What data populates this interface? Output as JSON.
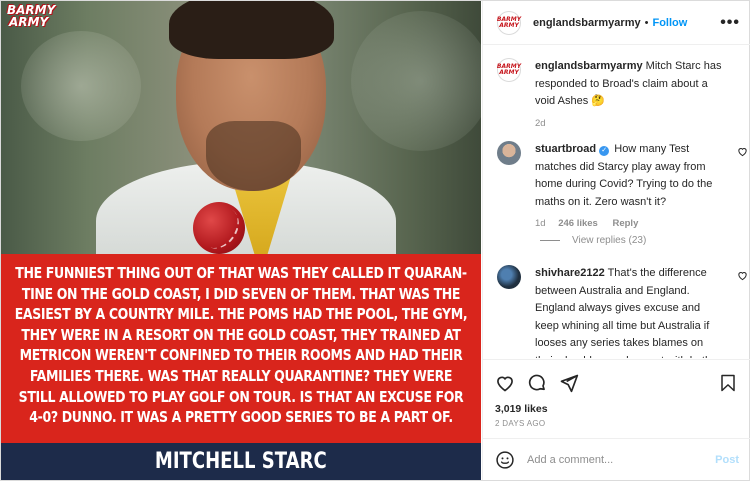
{
  "post": {
    "logo_line1": "BARMY",
    "logo_line2": "ARMY",
    "quote": "The funniest thing out of that was they called it quarantine on the Gold Coast, I did seven of them. That was the easiest by a country mile. The Poms had the pool, the gym, they were in a resort on the Gold Coast, they trained at Metricon weren't confined to their rooms and had their families there. Was that really quarantine? They were still allowed to play golf on tour. Is that an excuse for 4-0? Dunno. It was a pretty good series to be a part of.",
    "quote_lines": [
      "The funniest thing out of that was they called it quaran-",
      "tine on the Gold Coast, I did seven of them. That was the",
      "easiest by a country mile. The Poms had the pool, the gym,",
      "they were in a resort on the Gold Coast, they trained at",
      "Metricon weren't confined to their rooms and had their",
      "families there. Was that really quarantine? They were",
      "still allowed to play golf on tour. Is that an excuse for",
      "4-0? Dunno. It was a pretty good series to be a part of."
    ],
    "attribution": "MITCHELL STARC"
  },
  "header": {
    "username": "englandsbarmyarmy",
    "separator": "•",
    "follow_label": "Follow",
    "more_label": "•••",
    "avatar_text_1": "BARMY",
    "avatar_text_2": "ARMY"
  },
  "caption": {
    "username": "englandsbarmyarmy",
    "text": "Mitch Starc has responded to Broad's claim about a void Ashes 🤔",
    "time": "2d"
  },
  "comments": [
    {
      "username": "stuartbroad",
      "verified": true,
      "text": "How many Test matches did Starcy play away from home during Covid? Trying to do the maths on it. Zero wasn't it?",
      "time": "1d",
      "likes": "246 likes",
      "reply_label": "Reply",
      "view_replies": "View replies (23)"
    },
    {
      "username": "shivhare2122",
      "verified": false,
      "text": "That's the difference between Australia and England. England always gives excuse and keep whining all time but Australia if looses any series takes blames on their shoulders and accept with both hands. That's why Australia"
    }
  ],
  "actions": {
    "likes": "3,019 likes",
    "timestamp": "2 DAYS AGO",
    "icons": [
      "heart-icon",
      "comment-icon",
      "share-icon",
      "bookmark-icon"
    ]
  },
  "add_comment": {
    "placeholder": "Add a comment...",
    "post_label": "Post"
  },
  "colors": {
    "quote_bg": "#d9251c",
    "name_bar_bg": "#1d2b4a",
    "follow": "#0095f6",
    "post_disabled": "#b2dffc",
    "muted": "#8e8e8e"
  }
}
